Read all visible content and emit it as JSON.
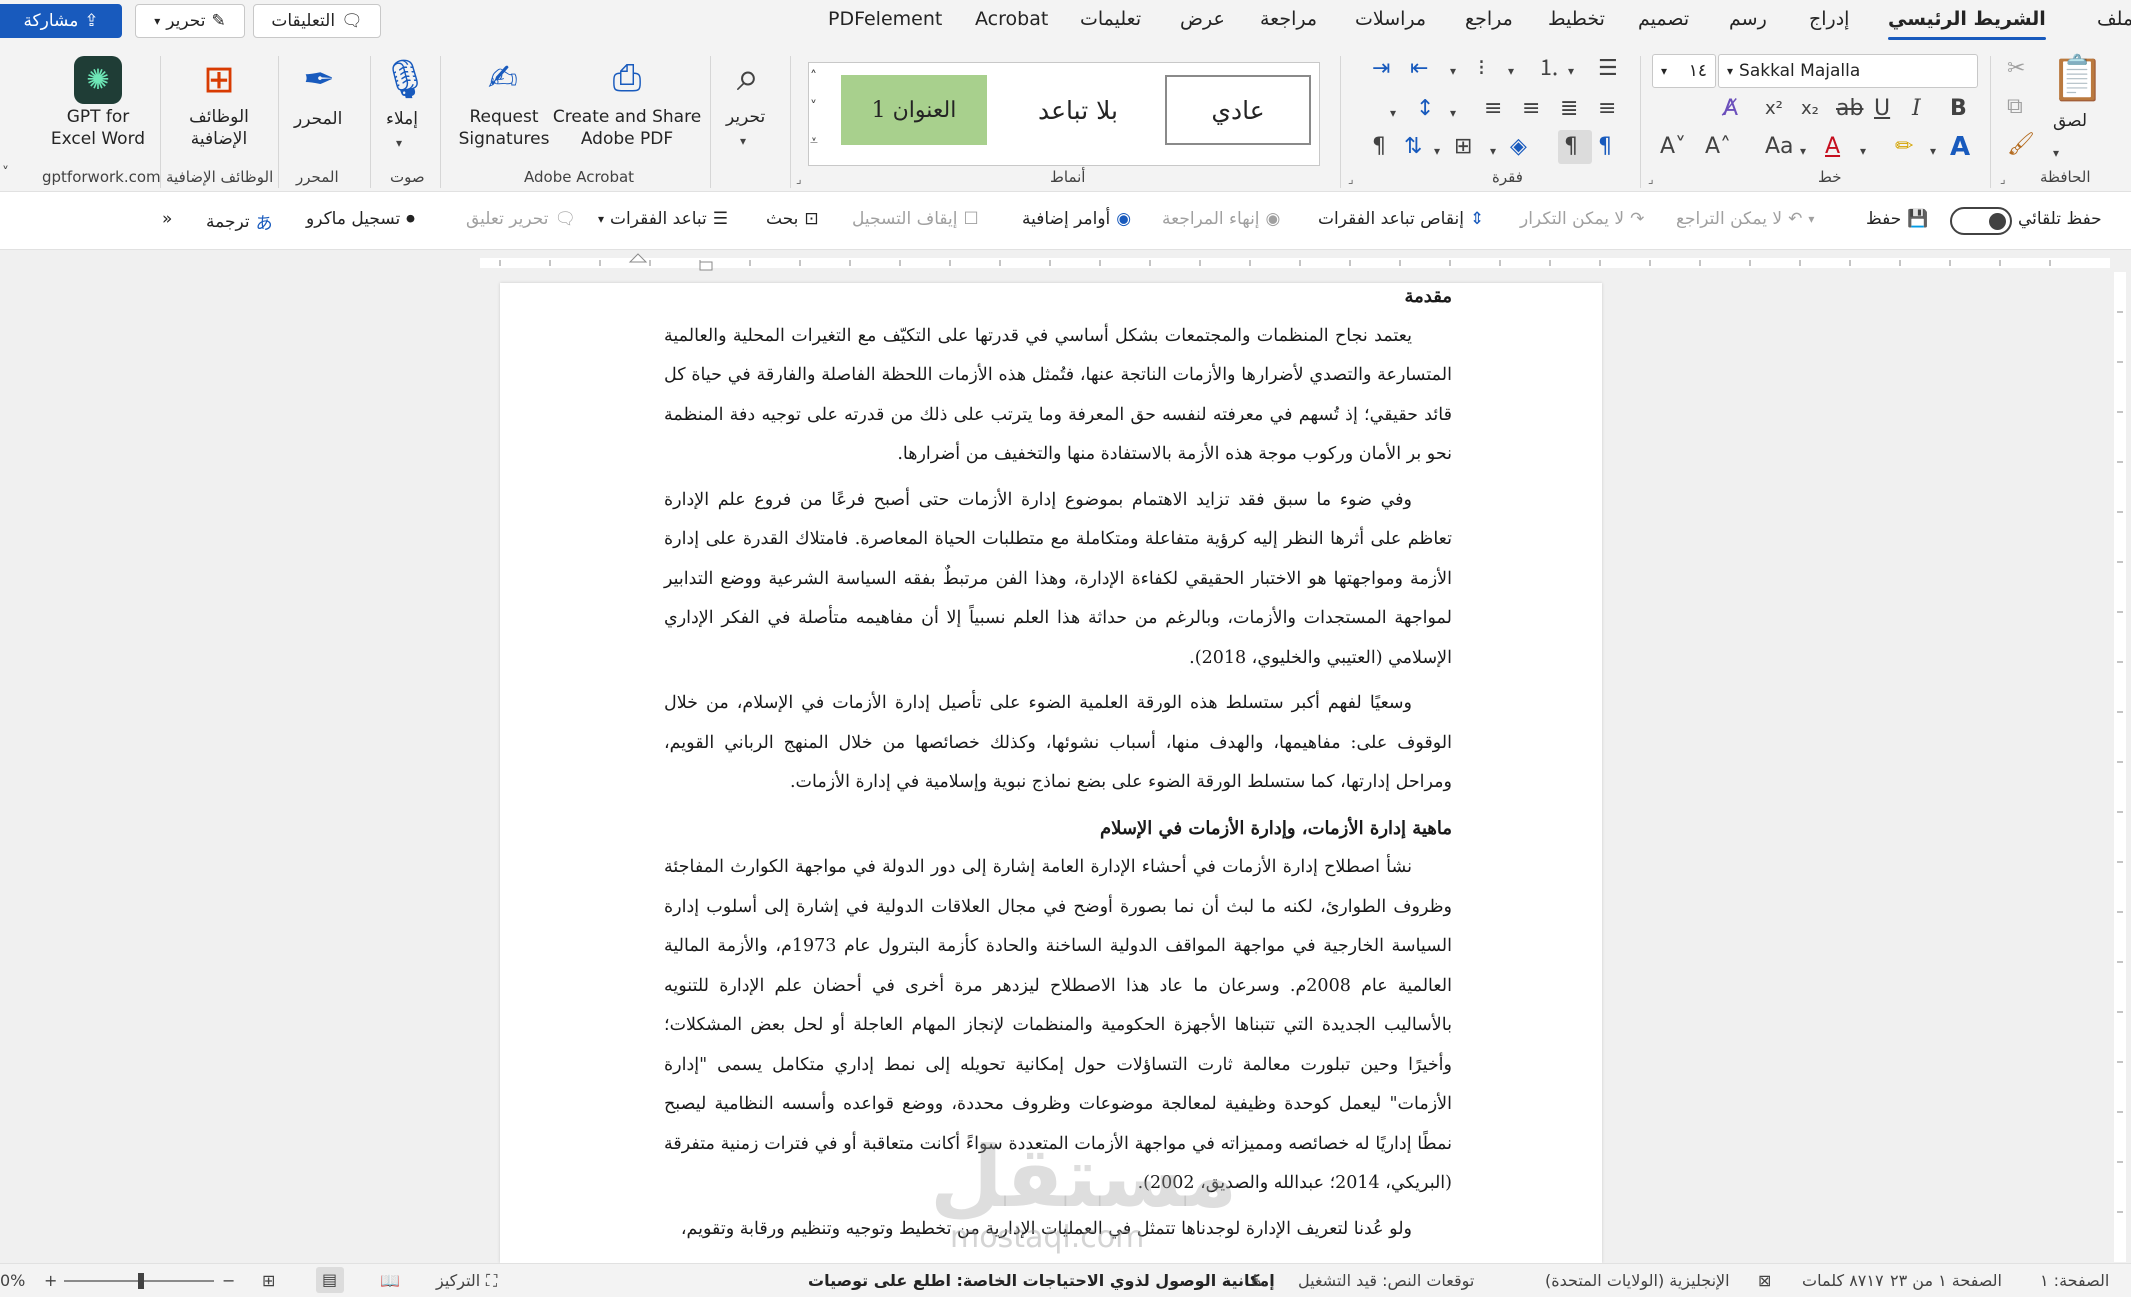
{
  "menubar": {
    "tabs": [
      "ملف",
      "الشريط الرئيسي",
      "إدراج",
      "رسم",
      "تصميم",
      "تخطيط",
      "مراجع",
      "مراسلات",
      "مراجعة",
      "عرض",
      "تعليمات",
      "Acrobat",
      "PDFelement"
    ],
    "active_tab": "الشريط الرئيسي",
    "comments_label": "التعليقات",
    "editing_label": "تحرير",
    "share_label": "مشاركة"
  },
  "ribbon": {
    "clipboard": {
      "paste": "لصق",
      "group": "الحافظة"
    },
    "font": {
      "name": "Sakkal Majalla",
      "size": "١٤",
      "group": "خط"
    },
    "paragraph": {
      "group": "فقرة"
    },
    "styles": {
      "items": [
        "عادي",
        "بلا تباعد",
        "العنوان 1"
      ],
      "group": "أنماط"
    },
    "editing": {
      "label": "تحرير"
    },
    "acrobat": {
      "create_share": "Create and Share Adobe PDF",
      "request_sig": "Request Signatures",
      "group": "Adobe Acrobat"
    },
    "voice": {
      "dictate": "إملاء",
      "group": "صوت"
    },
    "editor": {
      "label": "المحرر",
      "group": "المحرر"
    },
    "addins": {
      "label": "الوظائف الإضافية",
      "group": "الوظائف الإضافية"
    },
    "gpt": {
      "label": "GPT for Excel Word",
      "group": "gptforwork.com"
    }
  },
  "qat": {
    "autosave": "حفظ تلقائي",
    "save": "حفظ",
    "undo": "لا يمكن التراجع",
    "redo": "لا يمكن التكرار",
    "decrease_spacing": "إنقاص تباعد الفقرات",
    "end_review": "إنهاء المراجعة",
    "more_commands": "أوامر إضافية",
    "stop_recording": "إيقاف التسجيل",
    "search": "بحث",
    "para_spacing": "تباعد الفقرات",
    "edit_comment": "تحرير تعليق",
    "record_macro": "تسجيل ماكرو",
    "translate": "ترجمة",
    "overflow": "»"
  },
  "document": {
    "heading1": "مقدمة",
    "p1": "يعتمد نجاح المنظمات والمجتمعات بشكل أساسي في قدرتها على التكيّف مع التغيرات المحلية والعالمية المتسارعة والتصدي لأضرارها والأزمات الناتجة عنها، فتُمثل هذه الأزمات اللحظة الفاصلة والفارقة في حياة كل قائد حقيقي؛ إذ تُسهم في معرفته لنفسه حق المعرفة وما يترتب على ذلك من قدرته على توجيه دفة المنظمة نحو بر الأمان وركوب موجة هذه الأزمة بالاستفادة منها والتخفيف من أضرارها.",
    "p2": "وفي ضوء ما سبق فقد تزايد الاهتمام بموضوع إدارة الأزمات حتى أصبح فرعًا من فروع علم الإدارة تعاظم على أثرها النظر إليه كرؤية متفاعلة ومتكاملة مع متطلبات الحياة المعاصرة. فامتلاك القدرة على إدارة الأزمة ومواجهتها هو الاختبار الحقيقي لكفاءة الإدارة، وهذا الفن مرتبطٌ بفقه السياسة الشرعية ووضع التدابير لمواجهة المستجدات والأزمات، وبالرغم من حداثة هذا العلم نسبياً إلا أن مفاهيمه متأصلة في الفكر الإداري الإسلامي (العتيبي والخليوي، 2018).",
    "p3": "وسعيًا لفهم أكبر ستسلط هذه الورقة العلمية الضوء على تأصيل إدارة الأزمات في الإسلام، من خلال الوقوف على: مفاهيمها، والهدف منها، أسباب نشوئها، وكذلك خصائصها من خلال المنهج الرباني القويم، ومراحل إدارتها، كما ستسلط الورقة الضوء على بضع نماذج نبوية وإسلامية في إدارة الأزمات.",
    "heading2": "ماهية إدارة الأزمات، وإدارة الأزمات في الإسلام",
    "p4": "نشأ اصطلاح إدارة الأزمات في أحشاء الإدارة العامة إشارة إلى دور الدولة في مواجهة الكوارث المفاجئة وظروف الطوارئ، لكنه ما لبث أن نما بصورة أوضح في مجال العلاقات الدولية في إشارة إلى أسلوب إدارة السياسة الخارجية في مواجهة المواقف الدولية الساخنة والحادة كأزمة البترول عام 1973م، والأزمة المالية العالمية عام 2008م. وسرعان ما عاد هذا الاصطلاح ليزدهر مرة أخرى في أحضان علم الإدارة للتنويه بالأساليب الجديدة التي تتبناها الأجهزة الحكومية والمنظمات لإنجاز المهام العاجلة أو لحل بعض المشكلات؛ وأخيرًا وحين تبلورت معالمة ثارت التساؤلات حول إمكانية تحويله إلى نمط إداري متكامل يسمى \"إدارة الأزمات\" ليعمل كوحدة وظيفية لمعالجة موضوعات وظروف محددة، ووضع قواعده وأسسه النظامية ليصبح نمطًا إداريًا له خصائصه ومميزاته في مواجهة الأزمات المتعددة سواءً أكانت متعاقبة أو في فترات زمنية متفرقة (البريكي، 2014؛ عبدالله والصديق، 2002).",
    "p5": "ولو عُدنا لتعريف الإدارة لوجدناها تتمثل في العمليات الإدارية من تخطيط وتوجيه وتنظيم ورقابة وتقويم،"
  },
  "watermark": {
    "main": "مستقل",
    "sub": "mostaql.com"
  },
  "statusbar": {
    "page": "الصفحة: ١",
    "page_of": "الصفحة ١ من ٢٣",
    "words": "٨٧١٧ كلمات",
    "language": "الإنجليزية (الولايات المتحدة)",
    "text_predictions": "توقعات النص: قيد التشغيل",
    "accessibility": "إمكانية الوصول لذوي الاحتياجات الخاصة: اطلع على توصيات",
    "focus": "التركيز",
    "zoom": "0%"
  }
}
